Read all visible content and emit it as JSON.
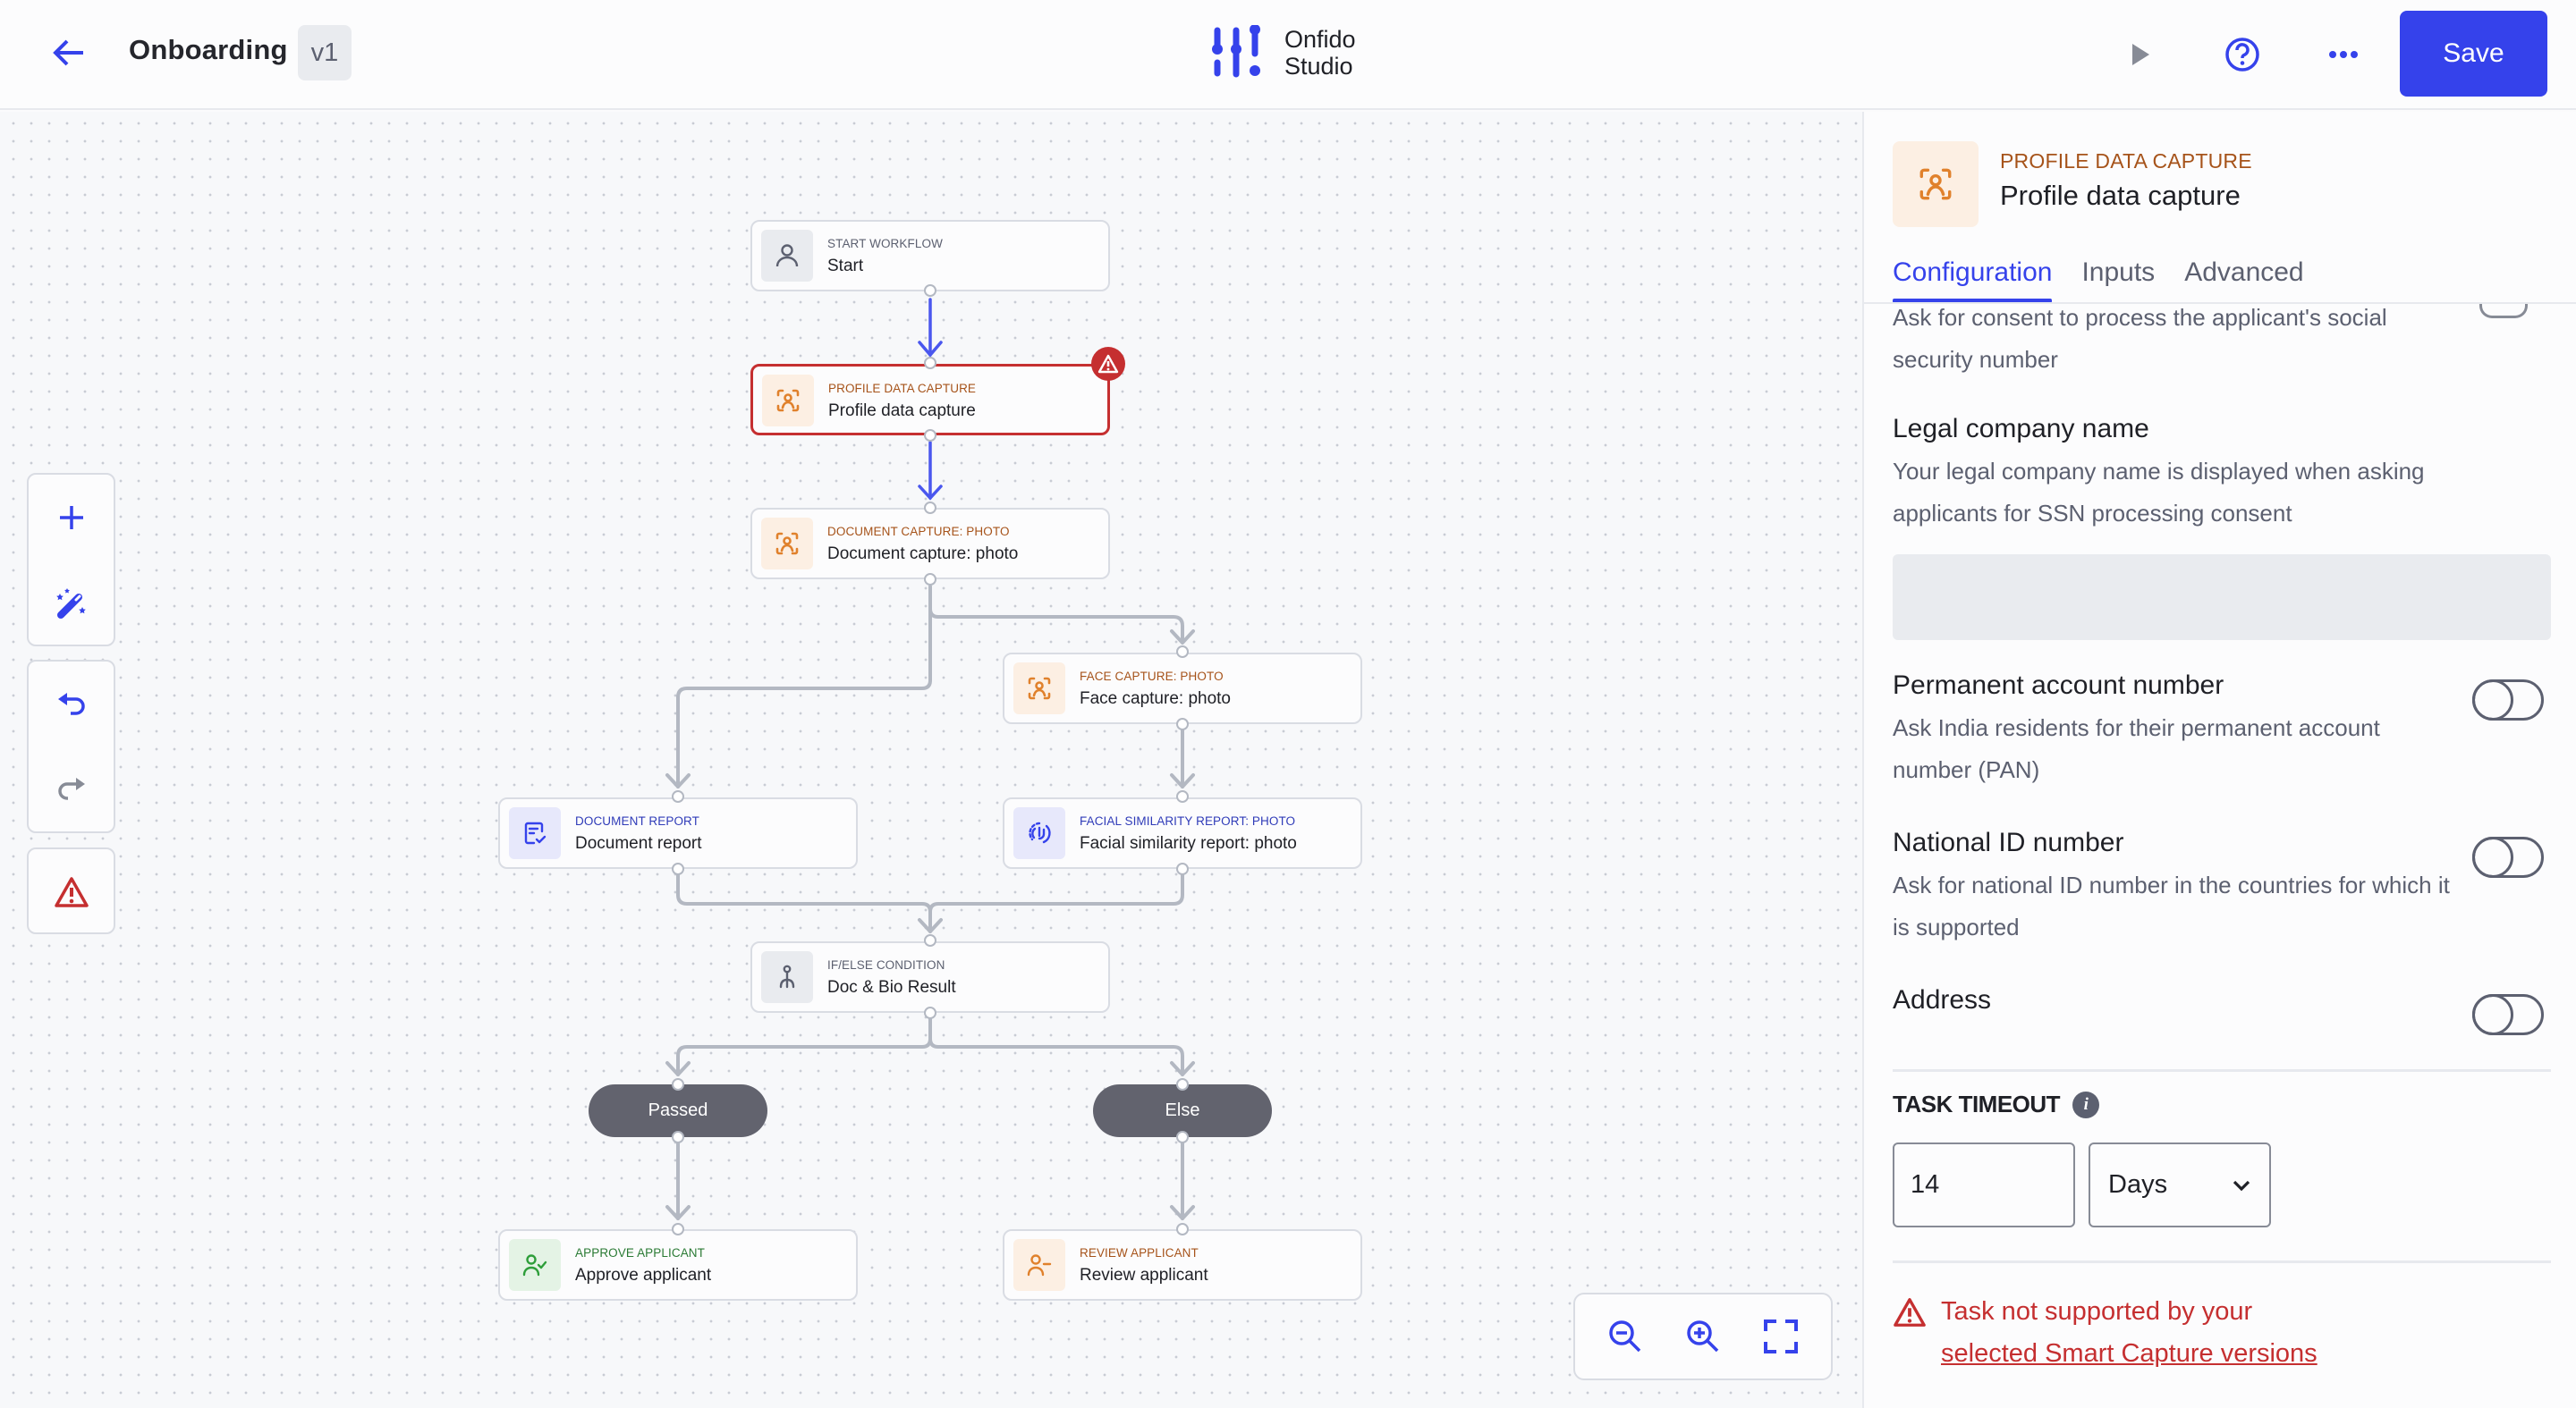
{
  "header": {
    "title": "Onboarding",
    "version": "v1",
    "logo_line1": "Onfido",
    "logo_line2": "Studio",
    "save_label": "Save",
    "accent": "#3542eb"
  },
  "canvas": {
    "nodes": [
      {
        "id": "start",
        "type": "START WORKFLOW",
        "label": "Start",
        "icon": "user-icon",
        "theme": "gray"
      },
      {
        "id": "profile",
        "type": "PROFILE DATA CAPTURE",
        "label": "Profile data capture",
        "icon": "face-scan-icon",
        "theme": "orange",
        "error": true,
        "selected": true
      },
      {
        "id": "doc-capture",
        "type": "DOCUMENT CAPTURE: PHOTO",
        "label": "Document capture: photo",
        "icon": "face-scan-icon",
        "theme": "orange"
      },
      {
        "id": "face-capture",
        "type": "FACE CAPTURE: PHOTO",
        "label": "Face capture: photo",
        "icon": "face-scan-icon",
        "theme": "orange"
      },
      {
        "id": "doc-report",
        "type": "DOCUMENT REPORT",
        "label": "Document report",
        "icon": "document-check-icon",
        "theme": "blue"
      },
      {
        "id": "facial-report",
        "type": "FACIAL SIMILARITY REPORT: PHOTO",
        "label": "Facial similarity report: photo",
        "icon": "fingerprint-icon",
        "theme": "blue"
      },
      {
        "id": "if-else",
        "type": "IF/ELSE CONDITION",
        "label": "Doc & Bio Result",
        "icon": "branch-icon",
        "theme": "gray"
      },
      {
        "id": "approve",
        "type": "APPROVE APPLICANT",
        "label": "Approve applicant",
        "icon": "user-check-icon",
        "theme": "green"
      },
      {
        "id": "review",
        "type": "REVIEW APPLICANT",
        "label": "Review applicant",
        "icon": "user-minus-icon",
        "theme": "orange"
      }
    ],
    "branches": [
      {
        "id": "passed",
        "label": "Passed"
      },
      {
        "id": "else",
        "label": "Else"
      }
    ]
  },
  "toolbar": {
    "items": [
      "add-node",
      "magic-wand",
      "undo",
      "redo",
      "warnings"
    ]
  },
  "zoom_controls": [
    "zoom-out",
    "zoom-in",
    "fit-view"
  ],
  "panel": {
    "type": "PROFILE DATA CAPTURE",
    "title": "Profile data capture",
    "tabs": [
      {
        "label": "Configuration",
        "active": true
      },
      {
        "label": "Inputs",
        "active": false
      },
      {
        "label": "Advanced",
        "active": false
      }
    ],
    "ssn_desc": "Ask for consent to process the applicant's social security number",
    "legal_company": {
      "title": "Legal company name",
      "desc": "Your legal company name is displayed when asking applicants for SSN processing consent",
      "value": ""
    },
    "toggles": [
      {
        "title": "Permanent account number",
        "desc": "Ask India residents for their permanent account number (PAN)",
        "on": false
      },
      {
        "title": "National ID number",
        "desc": "Ask for national ID number in the countries for which it is supported",
        "on": false
      },
      {
        "title": "Address",
        "desc": "",
        "on": false
      }
    ],
    "task_timeout": {
      "label": "TASK TIMEOUT",
      "value": "14",
      "unit": "Days"
    },
    "error": {
      "text": "Task not supported by your",
      "link": "selected Smart Capture versions",
      "color": "#c52f30"
    }
  }
}
